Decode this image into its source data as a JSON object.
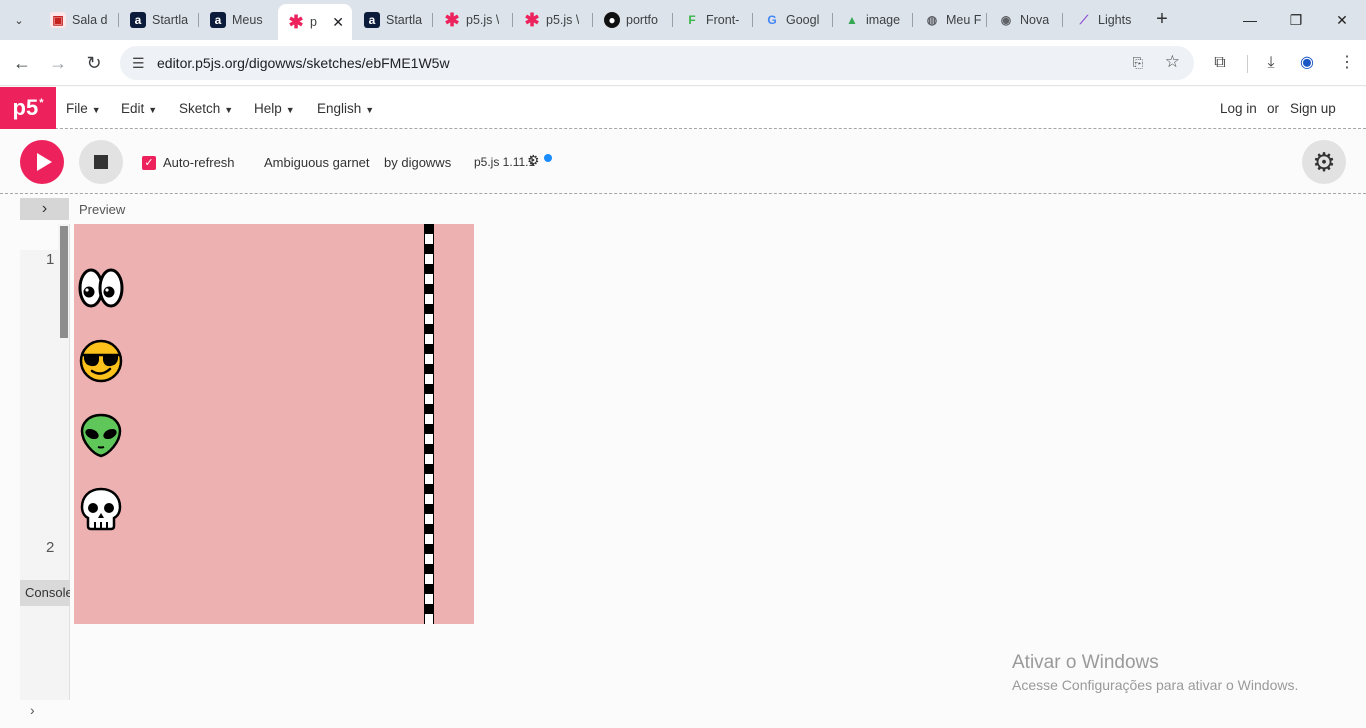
{
  "browser": {
    "tabs": [
      {
        "label": "Sala d",
        "favicon": "classroom-icon",
        "color": "#e8eaed"
      },
      {
        "label": "Startla",
        "favicon": "a-letter-icon",
        "color": "#0b1b3b"
      },
      {
        "label": "Meus",
        "favicon": "a-letter-icon",
        "color": "#0b1b3b"
      },
      {
        "label": "p",
        "favicon": "p5-asterisk-icon",
        "color": "#ed225d",
        "active": true
      },
      {
        "label": "Startla",
        "favicon": "a-letter-icon",
        "color": "#0b1b3b"
      },
      {
        "label": "p5.js \\",
        "favicon": "p5-asterisk-icon",
        "color": "#ed225d"
      },
      {
        "label": "p5.js \\",
        "favicon": "p5-asterisk-icon",
        "color": "#ed225d"
      },
      {
        "label": "portfo",
        "favicon": "github-icon",
        "color": "#111111"
      },
      {
        "label": "Front-",
        "favicon": "f-flag-icon",
        "color": "#3bb54a"
      },
      {
        "label": "Googl",
        "favicon": "google-icon",
        "color": "#4285f4"
      },
      {
        "label": "image",
        "favicon": "drive-icon",
        "color": "#34a853"
      },
      {
        "label": "Meu F",
        "favicon": "globe-icon",
        "color": "#5f6368"
      },
      {
        "label": "Nova",
        "favicon": "chrome-icon",
        "color": "#5f6368"
      },
      {
        "label": "Lights",
        "favicon": "feather-icon",
        "color": "#8a4bd6"
      }
    ],
    "url": "editor.p5js.org/digowws/sketches/ebFME1W5w"
  },
  "p5nav": {
    "logo": "p5",
    "logo_sup": "*",
    "menus": [
      "File",
      "Edit",
      "Sketch",
      "Help",
      "English"
    ],
    "login": "Log in",
    "or": "or",
    "signup": "Sign up"
  },
  "toolbar": {
    "auto_refresh_label": "Auto-refresh",
    "auto_refresh_checked": true,
    "sketch_name": "Ambiguous garnet",
    "by_user": "by digowws",
    "p5_version": "p5.js 1.11.1"
  },
  "editor": {
    "preview_label": "Preview",
    "line_numbers": [
      "1",
      "2"
    ],
    "console_label": "Console"
  },
  "canvas": {
    "background": "#eeb1b1",
    "racers": [
      {
        "name": "eyes-emoji",
        "glyph": "👀"
      },
      {
        "name": "sunglasses-face-emoji",
        "glyph": "😎"
      },
      {
        "name": "alien-emoji",
        "glyph": "👽"
      },
      {
        "name": "skull-emoji",
        "glyph": "💀"
      }
    ]
  },
  "watermark": {
    "title": "Ativar o Windows",
    "subtitle": "Acesse Configurações para ativar o Windows."
  },
  "colors": {
    "accent": "#ed225d",
    "canvas_bg": "#eeb1b1"
  }
}
